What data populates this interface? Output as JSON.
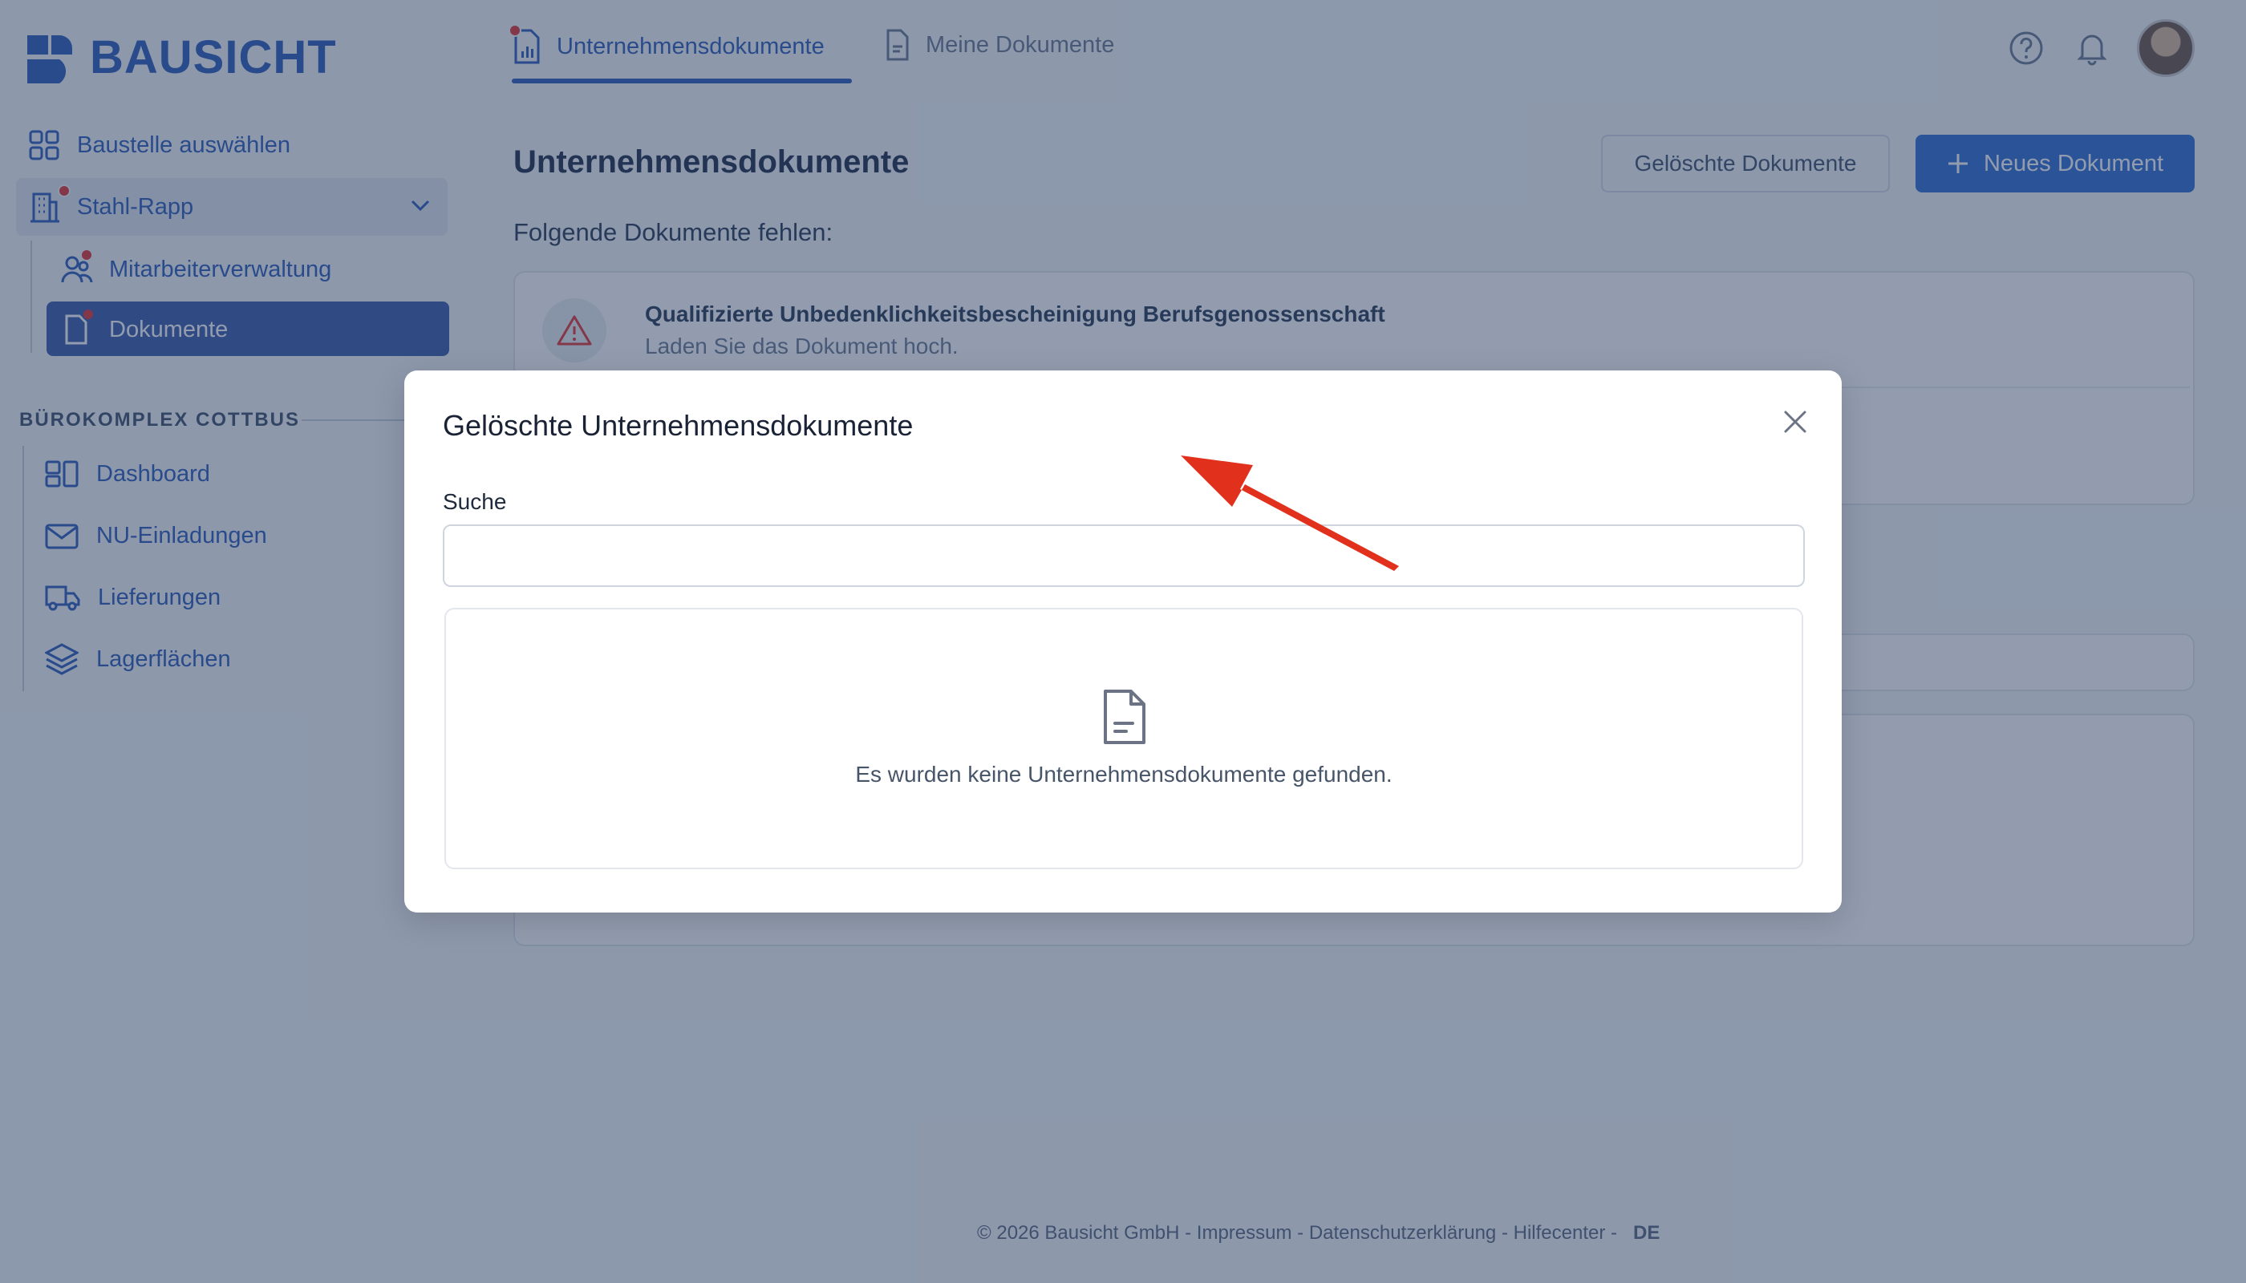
{
  "app": {
    "brand": "BAUSICHT"
  },
  "tabs": [
    {
      "label": "Unternehmensdokumente",
      "active": true
    },
    {
      "label": "Meine Dokumente",
      "active": false
    }
  ],
  "sidebar": {
    "select_site": "Baustelle auswählen",
    "site_name": "Stahl-Rapp",
    "site_items": [
      {
        "label": "Mitarbeiterverwaltung"
      },
      {
        "label": "Dokumente"
      }
    ],
    "section_title": "BÜROKOMPLEX COTTBUS",
    "section_items": [
      {
        "label": "Dashboard"
      },
      {
        "label": "NU-Einladungen"
      },
      {
        "label": "Lieferungen"
      },
      {
        "label": "Lagerflächen"
      }
    ]
  },
  "page": {
    "title": "Unternehmensdokumente",
    "deleted_button": "Gelöschte Dokumente",
    "new_button": "Neues Dokument",
    "missing_label": "Folgende Dokumente fehlen:",
    "missing_doc": {
      "title": "Qualifizierte Unbedenklichkeitsbescheinigung Berufsgenossenschaft",
      "subtitle": "Laden Sie das Dokument hoch."
    }
  },
  "modal": {
    "title": "Gelöschte Unternehmensdokumente",
    "search_label": "Suche",
    "search_value": "",
    "empty_text": "Es wurden keine Unternehmensdokumente gefunden."
  },
  "footer": {
    "copyright": "© 2026 Bausicht GmbH",
    "links": [
      "Impressum",
      "Datenschutzerklärung",
      "Hilfecenter"
    ],
    "language": "DE"
  },
  "colors": {
    "brand": "#2c5bb8",
    "primary_button": "#2e6fd0",
    "annotation_arrow": "#e1301c",
    "notification_dot": "#e03434"
  }
}
